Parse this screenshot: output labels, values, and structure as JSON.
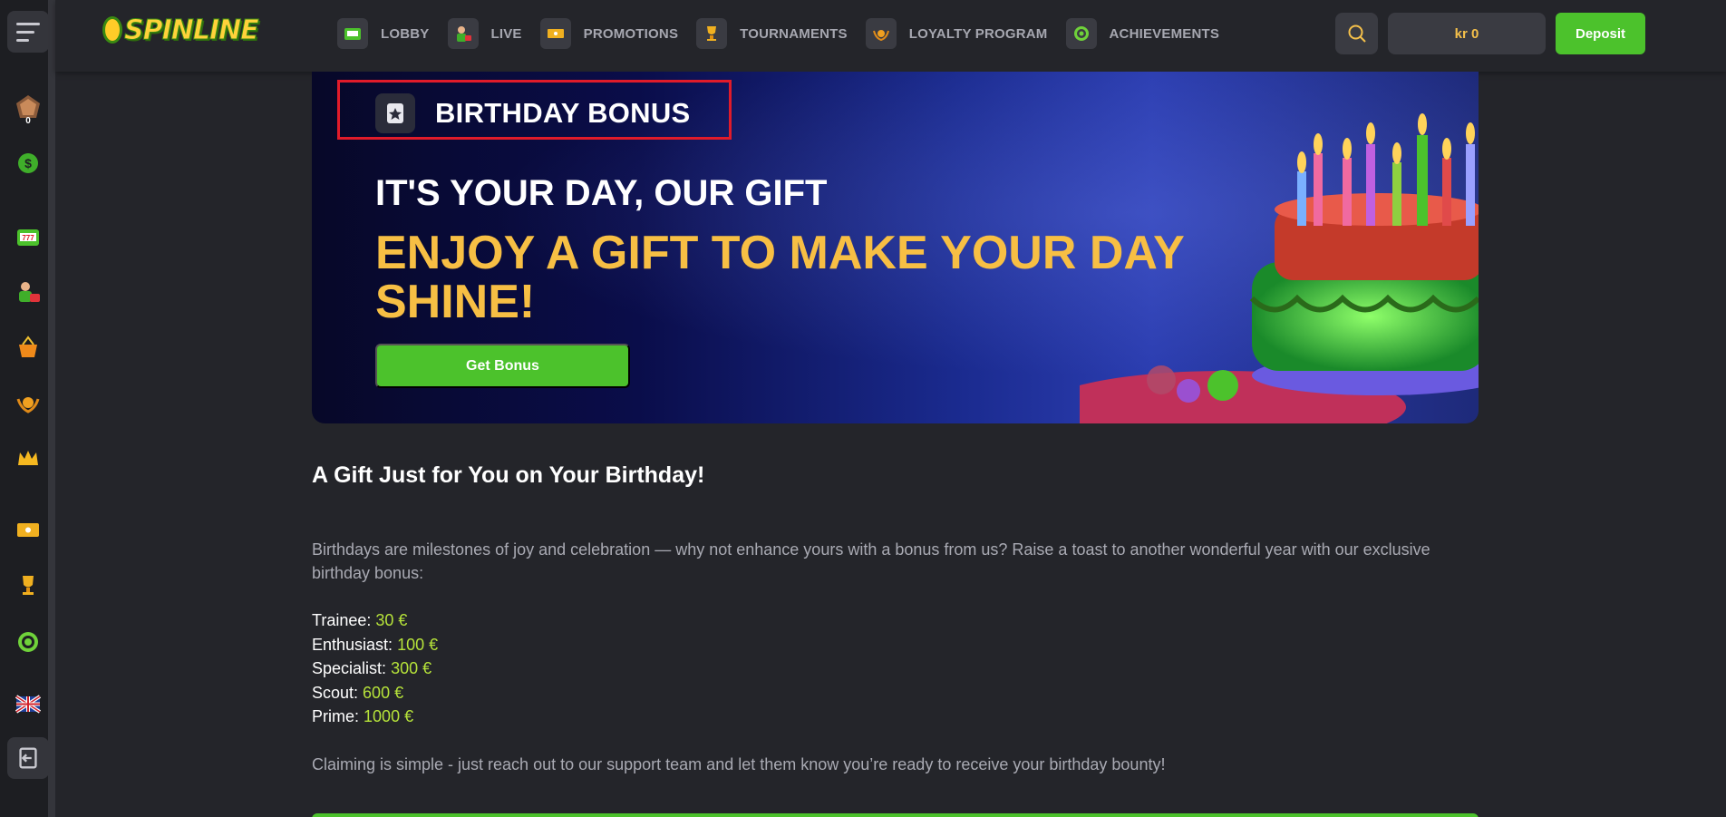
{
  "app": {
    "logo_text": "SPINLINE"
  },
  "nav": {
    "items": [
      {
        "label": "LOBBY",
        "icon": "slot-machine-icon"
      },
      {
        "label": "LIVE",
        "icon": "live-dealer-icon"
      },
      {
        "label": "PROMOTIONS",
        "icon": "ticket-icon"
      },
      {
        "label": "TOURNAMENTS",
        "icon": "trophy-icon"
      },
      {
        "label": "LOYALTY PROGRAM",
        "icon": "laurel-badge-icon"
      },
      {
        "label": "ACHIEVEMENTS",
        "icon": "target-icon"
      }
    ]
  },
  "header": {
    "balance": "kr 0",
    "deposit_label": "Deposit"
  },
  "sidebar": {
    "rank_count": "0"
  },
  "banner": {
    "title": "BIRTHDAY BONUS",
    "subtitle": "IT'S YOUR DAY, OUR GIFT",
    "headline": "ENJOY A GIFT TO MAKE YOUR DAY SHINE!",
    "cta_label": "Get Bonus"
  },
  "content": {
    "heading": "A Gift Just for You on Your Birthday!",
    "intro": "Birthdays are milestones of joy and celebration — why not enhance yours with a bonus from us? Raise a toast to another wonderful year with our exclusive birthday bonus:",
    "tiers": [
      {
        "name": "Trainee:",
        "amount": "30 €"
      },
      {
        "name": "Enthusiast:",
        "amount": "100 €"
      },
      {
        "name": "Specialist:",
        "amount": "300 €"
      },
      {
        "name": "Scout:",
        "amount": "600 €"
      },
      {
        "name": "Prime:",
        "amount": "1000 €"
      }
    ],
    "outro": "Claiming is simple - just reach out to our support team and let them know you’re ready to receive your birthday bounty!"
  },
  "colors": {
    "accent_green": "#4cc22c",
    "gold": "#f7bf44",
    "amount_green": "#b6e33a",
    "highlight_red": "#e01b2a"
  }
}
